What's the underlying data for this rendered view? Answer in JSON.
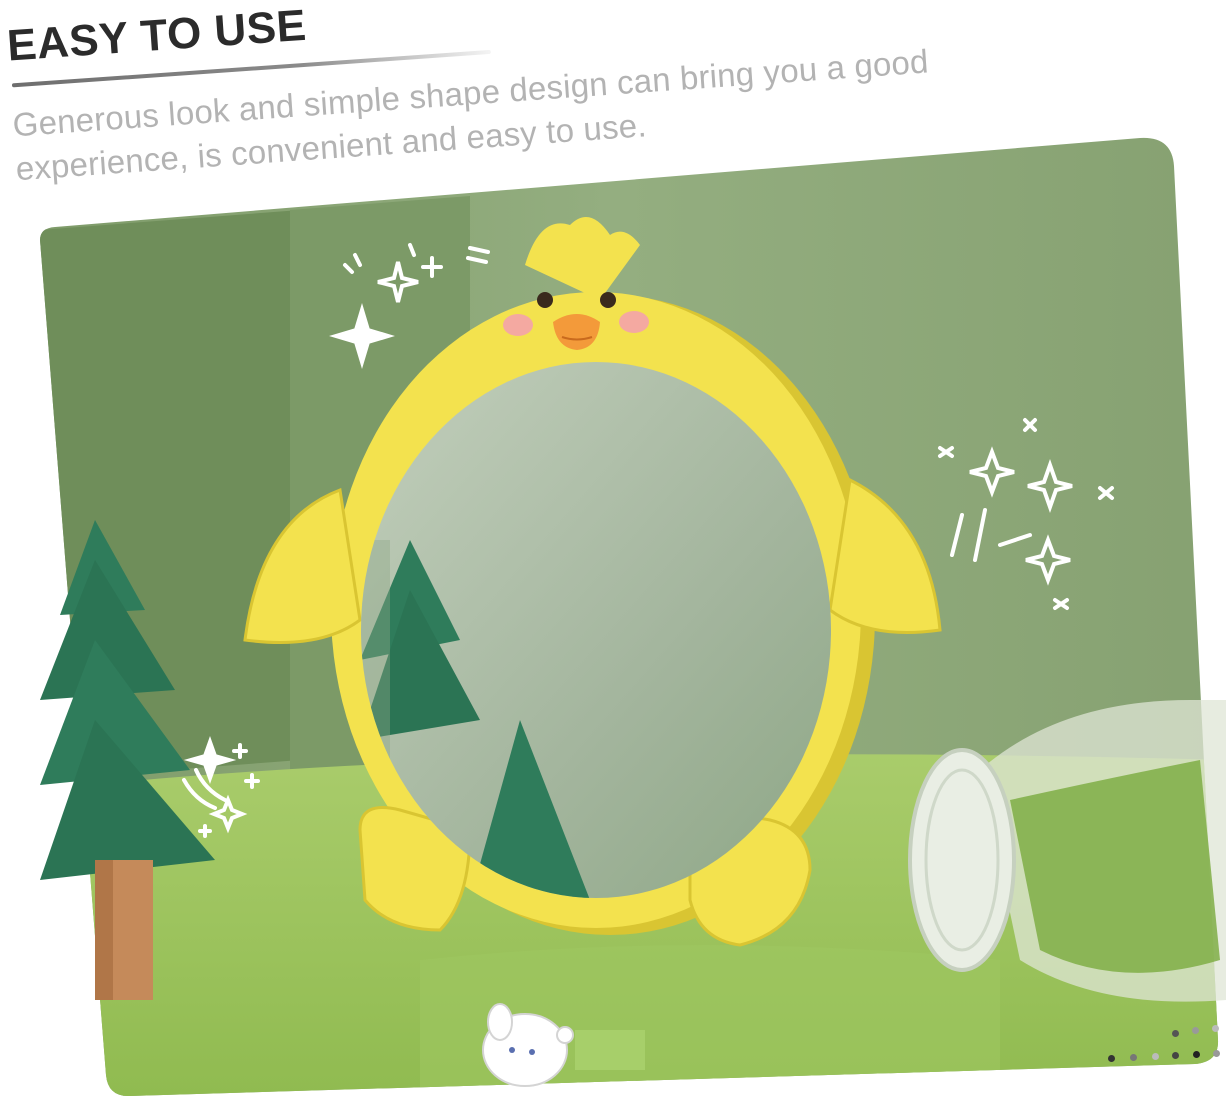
{
  "header": {
    "title": "EASY TO USE",
    "description": "Generous look and simple shape design can bring you a good experience, is convenient and easy to use."
  },
  "photo": {
    "subject": "yellow chick-shaped tabletop mirror",
    "colors": {
      "wall": "#8fa97c",
      "wall_dark": "#6f8f5c",
      "table": "#9cc45a",
      "chick": "#f3e24e",
      "chick_shade": "#d9c532",
      "mirror": "#a9b9a3",
      "tree": "#2f7c5b",
      "trunk": "#c58a5a",
      "jar": "#dfe6d6"
    }
  },
  "pagination": {
    "dot_icons": [
      "dot-icon",
      "dot-icon",
      "dot-icon",
      "dot-icon",
      "dot-icon",
      "dot-icon",
      "dot-icon",
      "dot-icon",
      "dot-icon"
    ]
  }
}
